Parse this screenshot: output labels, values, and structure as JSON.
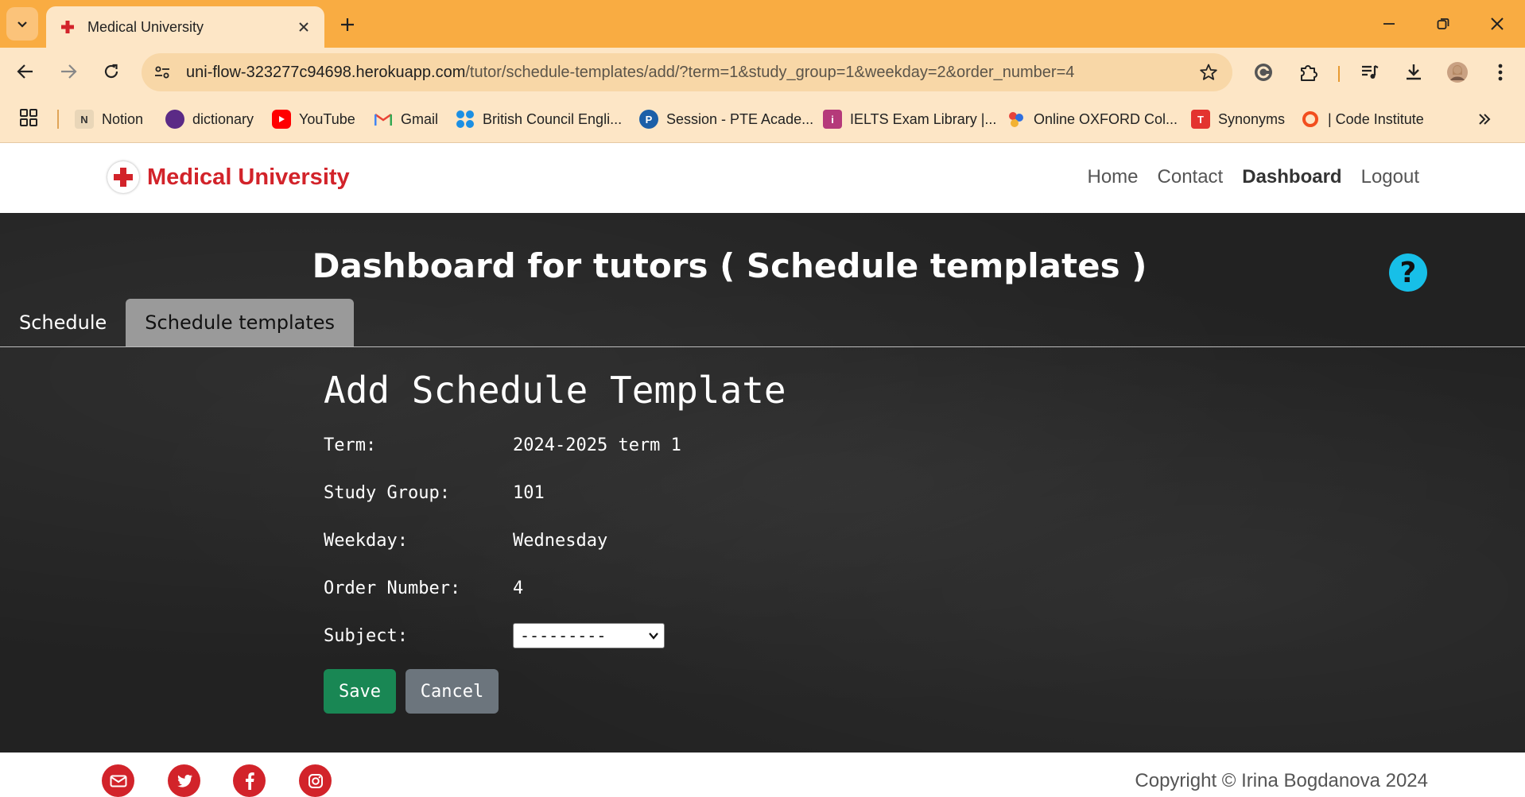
{
  "browser": {
    "tab_title": "Medical University",
    "url_host": "uni-flow-323277c94698.herokuapp.com",
    "url_path": "/tutor/schedule-templates/add/?term=1&study_group=1&weekday=2&order_number=4",
    "theme_color": "#f9ac42"
  },
  "bookmarks": [
    {
      "label": "Notion",
      "icon": "notion-icon"
    },
    {
      "label": "dictionary",
      "icon": "dictionary-icon"
    },
    {
      "label": "YouTube",
      "icon": "youtube-icon"
    },
    {
      "label": "Gmail",
      "icon": "gmail-icon"
    },
    {
      "label": "British Council Engli...",
      "icon": "british-council-icon"
    },
    {
      "label": "Session - PTE Acade...",
      "icon": "pte-icon"
    },
    {
      "label": "IELTS Exam Library |...",
      "icon": "ielts-icon"
    },
    {
      "label": "Online OXFORD Col...",
      "icon": "oxford-icon"
    },
    {
      "label": "Synonyms",
      "icon": "synonyms-icon"
    },
    {
      "label": "| Code Institute",
      "icon": "code-institute-icon"
    }
  ],
  "site": {
    "brand": "Medical University",
    "brand_color": "#d2232a",
    "nav": {
      "home": "Home",
      "contact": "Contact",
      "dashboard": "Dashboard",
      "logout": "Logout"
    }
  },
  "dashboard": {
    "title": "Dashboard for tutors ( Schedule templates )",
    "tabs": {
      "schedule": "Schedule",
      "templates": "Schedule templates"
    },
    "help_symbol": "?"
  },
  "form": {
    "title": "Add Schedule Template",
    "term": {
      "label": "Term:",
      "value": "2024-2025 term 1"
    },
    "study_group": {
      "label": "Study Group:",
      "value": "101"
    },
    "weekday": {
      "label": "Weekday:",
      "value": "Wednesday"
    },
    "order_number": {
      "label": "Order Number:",
      "value": "4"
    },
    "subject": {
      "label": "Subject:",
      "selected": "---------"
    },
    "save_label": "Save",
    "cancel_label": "Cancel"
  },
  "footer": {
    "copyright": "Copyright © Irina Bogdanova 2024"
  }
}
